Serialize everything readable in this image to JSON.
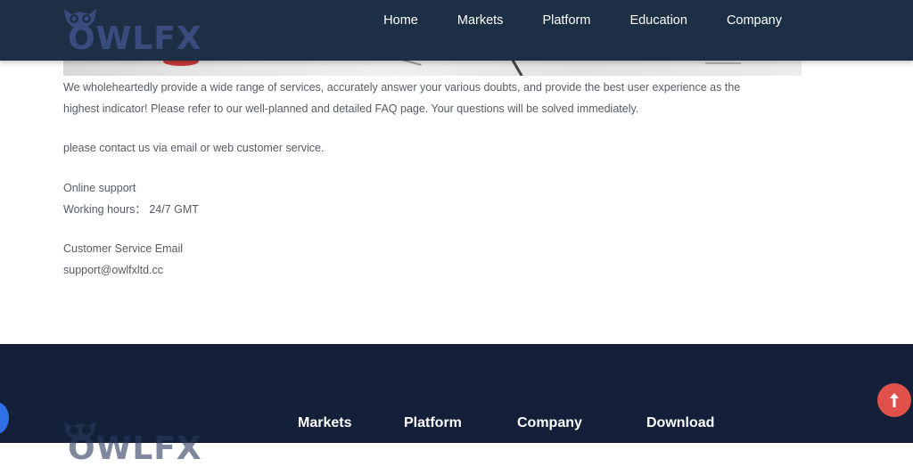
{
  "header": {
    "logo_text": "OWLFX",
    "nav": [
      "Home",
      "Markets",
      "Platform",
      "Education",
      "Company"
    ]
  },
  "content": {
    "intro": "We wholeheartedly provide a wide range of services, accurately answer your various doubts, and provide the best user experience as the highest indicator! Please refer to our well-planned and detailed FAQ page. Your questions will be solved immediately.",
    "contact": "please contact us via email or web customer service.",
    "online_support": "Online support",
    "working_hours": "Working hours：  24/7 GMT",
    "email_label": "Customer Service Email",
    "email": "support@owlfxltd.cc"
  },
  "footer": {
    "logo_text": "OWLFX",
    "columns": [
      "Markets",
      "Platform",
      "Company",
      "Download"
    ]
  },
  "colors": {
    "header_bg": "#1d2f45",
    "footer_bg": "#14203a",
    "scroll_top": "#e0514b",
    "chat": "#2f6fe8"
  },
  "icons": {
    "scroll_top": "arrow-up-icon",
    "logo": "owl-icon"
  }
}
